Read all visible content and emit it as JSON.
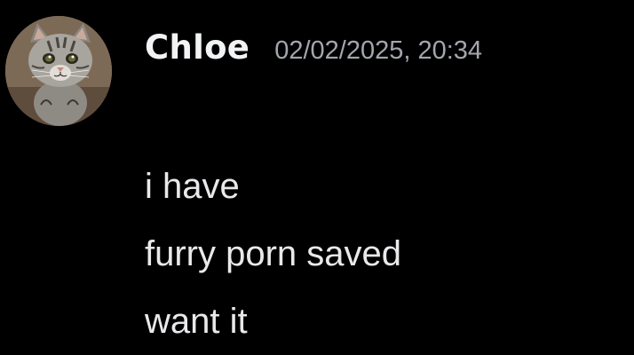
{
  "message": {
    "author": {
      "username": "Chloe",
      "avatar_icon": "cat-avatar-icon"
    },
    "timestamp": "02/02/2025, 20:34",
    "lines": [
      "i have",
      "furry porn saved",
      "want it"
    ]
  },
  "colors": {
    "background": "#000000",
    "username": "#f2f3f5",
    "timestamp": "#a3a6ad",
    "text": "#e8e9eb"
  }
}
